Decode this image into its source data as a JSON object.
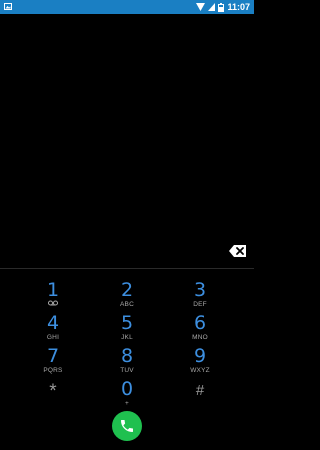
{
  "status_bar": {
    "background": "#1a7fc3",
    "left_icon": "image-notification-icon",
    "right_icons": [
      "wifi-icon",
      "signal-icon",
      "battery-icon"
    ],
    "time": "11:07"
  },
  "dialer": {
    "accent_color": "#3d8fe0",
    "backspace_icon": "backspace-icon",
    "keys": [
      {
        "digit": "1",
        "letters": "",
        "icon": "voicemail-icon"
      },
      {
        "digit": "2",
        "letters": "ABC"
      },
      {
        "digit": "3",
        "letters": "DEF"
      },
      {
        "digit": "4",
        "letters": "GHI"
      },
      {
        "digit": "5",
        "letters": "JKL"
      },
      {
        "digit": "6",
        "letters": "MNO"
      },
      {
        "digit": "7",
        "letters": "PQRS"
      },
      {
        "digit": "8",
        "letters": "TUV"
      },
      {
        "digit": "9",
        "letters": "WXYZ"
      },
      {
        "digit": "*",
        "letters": ""
      },
      {
        "digit": "0",
        "letters": "+"
      },
      {
        "digit": "#",
        "letters": ""
      }
    ],
    "call_button_color": "#1fc04f",
    "call_icon": "phone-icon"
  }
}
